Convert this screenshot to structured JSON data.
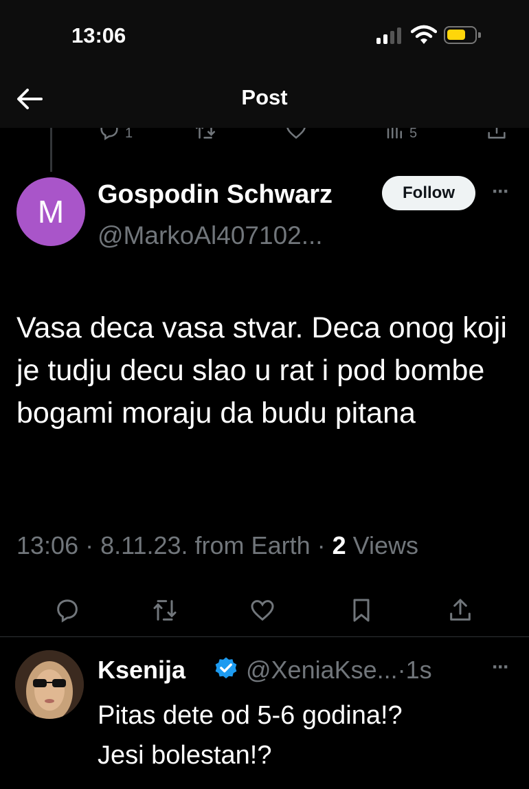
{
  "status_bar": {
    "time": "13:06"
  },
  "header": {
    "title": "Post"
  },
  "previous_post_actions": {
    "reply_count": "1",
    "views_count": "5"
  },
  "post": {
    "avatar_letter": "M",
    "author_name": "Gospodin Schwarz",
    "author_handle": "@MarkoAl407102...",
    "follow_label": "Follow",
    "more_label": "···",
    "text": "Vasa deca vasa stvar. Deca onog koji je tudju decu slao u rat i pod bombe bogami moraju da budu pitana",
    "meta": {
      "time": "13:06",
      "sep1": " · ",
      "date": "8.11.23.",
      "source": " from Earth",
      "sep2": " · ",
      "views_count": "2",
      "views_label": " Views"
    }
  },
  "reply": {
    "author_name": "Ksenija",
    "author_handle": "@XeniaKse...",
    "age": "·1s",
    "more_label": "···",
    "text_line1": "Pitas dete od 5-6 godina!?",
    "text_line2": "Jesi bolestan!?"
  },
  "colors": {
    "background": "#000000",
    "secondary_text": "#71767b",
    "avatar_purple": "#a955c9",
    "verified_blue": "#1d9bf0",
    "battery_yellow": "#ffd60a"
  }
}
